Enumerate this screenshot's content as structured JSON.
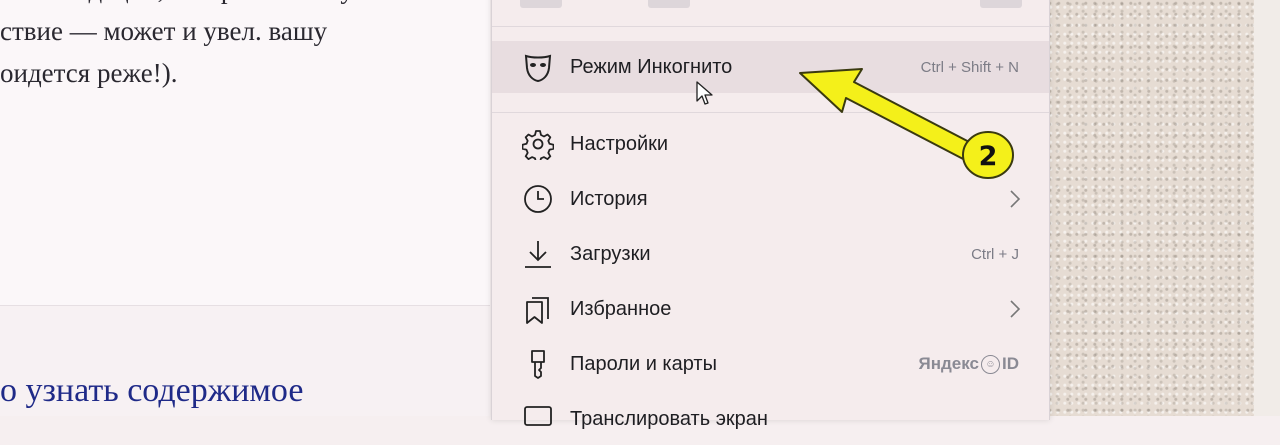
{
  "article": {
    "lines": [
      "...комендации, которые помогу-",
      "ствие — может и увел. вашу",
      "оидется реже!)."
    ],
    "heading": "о узнать содержимое"
  },
  "menu": {
    "items": [
      {
        "label": "Режим Инкогнито",
        "shortcut": "Ctrl + Shift + N",
        "icon": "incognito-mask-icon",
        "active": true
      },
      {
        "label": "Настройки",
        "icon": "gear-icon"
      },
      {
        "label": "История",
        "icon": "clock-icon",
        "submenu": true
      },
      {
        "label": "Загрузки",
        "shortcut": "Ctrl + J",
        "icon": "download-icon"
      },
      {
        "label": "Избранное",
        "icon": "bookmarks-icon",
        "submenu": true
      },
      {
        "label": "Пароли и карты",
        "icon": "key-icon",
        "brand": "Яндекс",
        "brand_suffix": "ID"
      },
      {
        "label": "Транслировать экран",
        "icon": "cast-icon"
      }
    ]
  },
  "annotation": {
    "badge_number": "2",
    "color": "#f4f01a"
  },
  "colors": {
    "menu_bg": "#f5eced",
    "active_bg": "#e8dde0",
    "heading_blue": "#1f2a88"
  }
}
